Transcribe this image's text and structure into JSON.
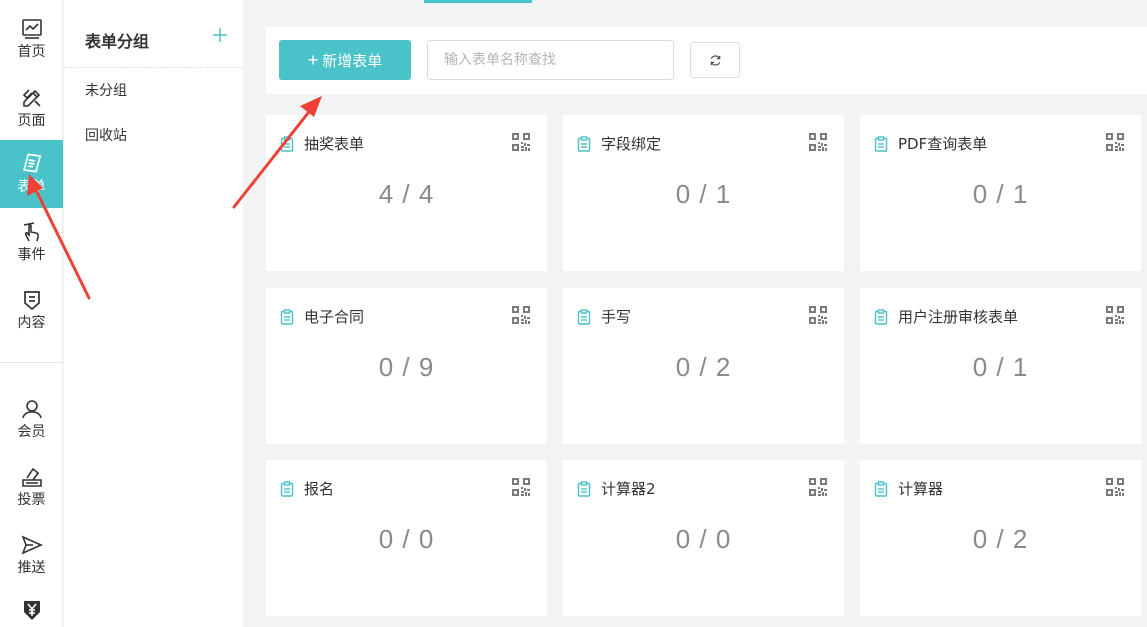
{
  "nav": {
    "items": [
      {
        "label": "首页",
        "icon": "chart-icon"
      },
      {
        "label": "页面",
        "icon": "design-tools-icon"
      },
      {
        "label": "表单",
        "icon": "form-icon",
        "active": true
      },
      {
        "label": "事件",
        "icon": "touch-hand-icon"
      },
      {
        "label": "内容",
        "icon": "content-shield-icon"
      },
      {
        "label": "会员",
        "icon": "user-icon"
      },
      {
        "label": "投票",
        "icon": "vote-box-icon"
      },
      {
        "label": "推送",
        "icon": "send-icon"
      },
      {
        "label": "",
        "icon": "yen-shield-icon"
      }
    ]
  },
  "groups": {
    "title": "表单分组",
    "add_icon": "plus-icon",
    "items": [
      "未分组",
      "回收站"
    ]
  },
  "toolbar": {
    "add_label": "新增表单",
    "search_placeholder": "输入表单名称查找",
    "refresh_icon": "refresh-icon"
  },
  "forms": [
    {
      "name": "抽奖表单",
      "count": "4 / 4"
    },
    {
      "name": "字段绑定",
      "count": "0 / 1"
    },
    {
      "name": "PDF查询表单",
      "count": "0 / 1"
    },
    {
      "name": "电子合同",
      "count": "0 / 9"
    },
    {
      "name": "手写",
      "count": "0 / 2"
    },
    {
      "name": "用户注册审核表单",
      "count": "0 / 1"
    },
    {
      "name": "报名",
      "count": "0 / 0"
    },
    {
      "name": "计算器2",
      "count": "0 / 0"
    },
    {
      "name": "计算器",
      "count": "0 / 2"
    }
  ],
  "colors": {
    "accent": "#49c2c9",
    "annotation": "#ef4136"
  }
}
